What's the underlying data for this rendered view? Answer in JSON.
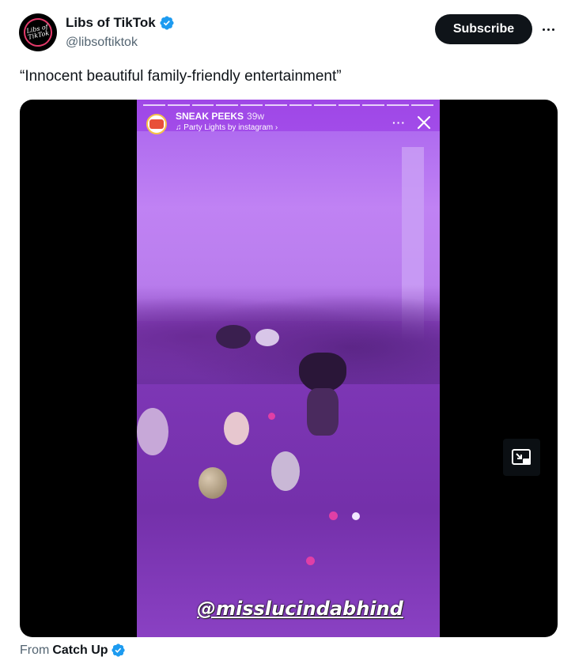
{
  "author": {
    "display_name": "Libs of TikTok",
    "handle": "@libsoftiktok",
    "avatar_text": "Libs of TikTok",
    "verified_icon": "verified-badge-icon"
  },
  "actions": {
    "subscribe_label": "Subscribe",
    "more_icon": "more-options-icon"
  },
  "tweet": {
    "text": "“Innocent beautiful family-friendly entertainment”"
  },
  "media": {
    "story": {
      "account": "SNEAK PEEKS",
      "time": "39w",
      "music": "♫ Party Lights by instagram ›",
      "more_label": "···",
      "close_icon": "close-icon"
    },
    "caption": "@misslucindabhind",
    "pip_icon": "picture-in-picture-icon"
  },
  "footer": {
    "from_label": "From",
    "source": "Catch Up"
  },
  "colors": {
    "verified": "#1d9bf0",
    "subscribe_bg": "#0f1419",
    "secondary_text": "#536471"
  }
}
